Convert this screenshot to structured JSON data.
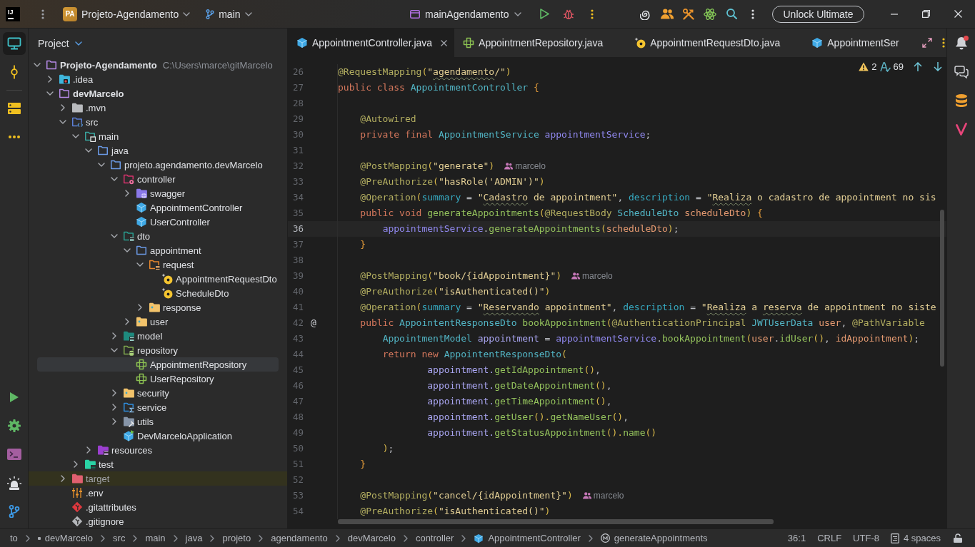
{
  "title_bar": {
    "logo": "IJ",
    "project_badge": "PA",
    "project": "Projeto-Agendamento",
    "branch": "main",
    "run_config": "mainAgendamento",
    "upgrade_button": "Unlock Ultimate"
  },
  "left_toolbar": {
    "top": [
      {
        "kind": "project",
        "selected": true
      },
      {
        "kind": "commit",
        "selected": false
      },
      {
        "kind": "structure",
        "selected": false
      },
      {
        "kind": "more",
        "selected": false
      }
    ],
    "bottom": [
      {
        "kind": "run",
        "selected": false
      },
      {
        "kind": "services",
        "selected": false
      },
      {
        "kind": "terminal",
        "selected": false
      },
      {
        "kind": "problems",
        "selected": false
      },
      {
        "kind": "git",
        "selected": false
      }
    ]
  },
  "project_panel": {
    "title": "Project",
    "tree": [
      {
        "label": "Projeto-Agendamento",
        "path": "C:\\Users\\marce\\gitMarcelo",
        "kind": "module",
        "expanded": true,
        "selected": false,
        "children": [
          {
            "label": ".idea",
            "kind": "idea",
            "expanded": false,
            "selected": false
          },
          {
            "label": "devMarcelo",
            "kind": "module",
            "expanded": true,
            "selected": false,
            "children": [
              {
                "label": ".mvn",
                "kind": "folder",
                "expanded": false,
                "selected": false
              },
              {
                "label": "src",
                "kind": "src",
                "expanded": true,
                "selected": false,
                "children": [
                  {
                    "label": "main",
                    "kind": "sources-root",
                    "expanded": true,
                    "selected": false,
                    "children": [
                      {
                        "label": "java",
                        "kind": "package",
                        "expanded": true,
                        "selected": false,
                        "children": [
                          {
                            "label": "projeto.agendamento.devMarcelo",
                            "kind": "package",
                            "expanded": true,
                            "selected": false,
                            "children": [
                              {
                                "label": "controller",
                                "kind": "controller",
                                "expanded": true,
                                "selected": false,
                                "children": [
                                  {
                                    "label": "swagger",
                                    "kind": "swagger",
                                    "expanded": false,
                                    "selected": false
                                  },
                                  {
                                    "label": "AppointmentController",
                                    "kind": "class",
                                    "selected": false
                                  },
                                  {
                                    "label": "UserController",
                                    "kind": "class",
                                    "selected": false
                                  }
                                ]
                              },
                              {
                                "label": "dto",
                                "kind": "dto",
                                "expanded": true,
                                "selected": false,
                                "children": [
                                  {
                                    "label": "appointment",
                                    "kind": "package",
                                    "expanded": true,
                                    "selected": false,
                                    "children": [
                                      {
                                        "label": "request",
                                        "kind": "request",
                                        "expanded": true,
                                        "selected": false,
                                        "children": [
                                          {
                                            "label": "AppointmentRequestDto",
                                            "kind": "record",
                                            "selected": false
                                          },
                                          {
                                            "label": "ScheduleDto",
                                            "kind": "record",
                                            "selected": false
                                          }
                                        ]
                                      },
                                      {
                                        "label": "response",
                                        "kind": "subpackage",
                                        "expanded": false,
                                        "selected": false
                                      }
                                    ]
                                  },
                                  {
                                    "label": "user",
                                    "kind": "subpackage",
                                    "expanded": false,
                                    "selected": false
                                  }
                                ]
                              },
                              {
                                "label": "model",
                                "kind": "model",
                                "expanded": false,
                                "selected": false
                              },
                              {
                                "label": "repository",
                                "kind": "repository",
                                "expanded": true,
                                "selected": false,
                                "children": [
                                  {
                                    "label": "AppointmentRepository",
                                    "kind": "interface",
                                    "selected": true
                                  },
                                  {
                                    "label": "UserRepository",
                                    "kind": "interface",
                                    "selected": false
                                  }
                                ]
                              },
                              {
                                "label": "security",
                                "kind": "subpackage",
                                "expanded": false,
                                "selected": false
                              },
                              {
                                "label": "service",
                                "kind": "service",
                                "expanded": false,
                                "selected": false
                              },
                              {
                                "label": "utils",
                                "kind": "utils",
                                "expanded": false,
                                "selected": false
                              },
                              {
                                "label": "DevMarceloApplication",
                                "kind": "application",
                                "selected": false
                              }
                            ]
                          }
                        ]
                      },
                      {
                        "label": "resources",
                        "kind": "resources",
                        "expanded": false,
                        "selected": false
                      }
                    ]
                  },
                  {
                    "label": "test",
                    "kind": "test",
                    "expanded": false,
                    "selected": false
                  }
                ]
              },
              {
                "label": "target",
                "kind": "excluded",
                "expanded": false,
                "selected": false
              },
              {
                "label": ".env",
                "kind": "env",
                "selected": false
              },
              {
                "label": ".gitattributes",
                "kind": "git",
                "selected": false
              },
              {
                "label": ".gitignore",
                "kind": "git-ignored",
                "selected": false
              }
            ]
          }
        ]
      }
    ]
  },
  "editor": {
    "tabs": [
      {
        "label": "AppointmentController.java",
        "kind": "class",
        "selected": true
      },
      {
        "label": "AppointmentRepository.java",
        "kind": "interface",
        "selected": false
      },
      {
        "label": "AppointmentRequestDto.java",
        "kind": "record",
        "selected": false
      },
      {
        "label": "AppointmentSer",
        "kind": "class",
        "selected": false
      }
    ],
    "inspections": {
      "warnings": "2",
      "typos": "69"
    },
    "lines": [
      {
        "number": "26",
        "current": false,
        "tokens": [
          {
            "kind": "annotation",
            "text": "@RequestMapping"
          },
          {
            "kind": "bracket",
            "text": "("
          },
          {
            "kind": "string",
            "text": "\""
          },
          {
            "kind": "typo",
            "text": "agendamento"
          },
          {
            "kind": "string",
            "text": "/\""
          },
          {
            "kind": "bracket",
            "text": ")"
          }
        ]
      },
      {
        "number": "27",
        "current": false,
        "tokens": [
          {
            "kind": "keyword",
            "text": "public class "
          },
          {
            "kind": "class",
            "text": "AppointmentController"
          },
          {
            "kind": "brace",
            "text": " {"
          }
        ]
      },
      {
        "number": "28",
        "current": false
      },
      {
        "number": "29",
        "current": false,
        "tokens": [
          {
            "kind": "annotation",
            "text": "    @Autowired"
          }
        ]
      },
      {
        "number": "30",
        "current": false,
        "tokens": [
          {
            "kind": "keyword",
            "text": "    private final "
          },
          {
            "kind": "class",
            "text": "AppointmentService"
          },
          {
            "kind": "field",
            "text": " appointmentService"
          },
          {
            "kind": "plain",
            "text": ";"
          }
        ]
      },
      {
        "number": "31",
        "current": false
      },
      {
        "number": "32",
        "current": false,
        "author": "marcelo",
        "tokens": [
          {
            "kind": "annotation",
            "text": "    @PostMapping"
          },
          {
            "kind": "bracket",
            "text": "("
          },
          {
            "kind": "string",
            "text": "\"generate\""
          },
          {
            "kind": "bracket",
            "text": ")"
          }
        ]
      },
      {
        "number": "33",
        "current": false,
        "tokens": [
          {
            "kind": "annotation",
            "text": "    @PreAuthorize"
          },
          {
            "kind": "bracket",
            "text": "("
          },
          {
            "kind": "string",
            "text": "\"hasRole('ADMIN')\""
          },
          {
            "kind": "bracket",
            "text": ")"
          }
        ]
      },
      {
        "number": "34",
        "current": false,
        "tokens": [
          {
            "kind": "annotation",
            "text": "    @Operation"
          },
          {
            "kind": "bracket",
            "text": "("
          },
          {
            "kind": "named",
            "text": "summary"
          },
          {
            "kind": "plain",
            "text": " = "
          },
          {
            "kind": "string",
            "text": "\""
          },
          {
            "kind": "typo",
            "text": "Cadastro"
          },
          {
            "kind": "string",
            "text": " de appointment\""
          },
          {
            "kind": "plain",
            "text": ", "
          },
          {
            "kind": "named",
            "text": "description"
          },
          {
            "kind": "plain",
            "text": " = "
          },
          {
            "kind": "string",
            "text": "\""
          },
          {
            "kind": "typo",
            "text": "Realiza"
          },
          {
            "kind": "string",
            "text": " o cadastro de appointment no sis"
          }
        ]
      },
      {
        "number": "35",
        "current": false,
        "tokens": [
          {
            "kind": "keyword",
            "text": "    public void "
          },
          {
            "kind": "method",
            "text": "generateAppointments"
          },
          {
            "kind": "bracket",
            "text": "("
          },
          {
            "kind": "annotation",
            "text": "@RequestBody"
          },
          {
            "kind": "class",
            "text": " ScheduleDto"
          },
          {
            "kind": "param",
            "text": " scheduleDto"
          },
          {
            "kind": "bracket",
            "text": ")"
          },
          {
            "kind": "brace",
            "text": " {"
          }
        ]
      },
      {
        "number": "36",
        "current": true,
        "tokens": [
          {
            "kind": "field",
            "text": "        appointmentService"
          },
          {
            "kind": "plain",
            "text": "."
          },
          {
            "kind": "method",
            "text": "generateAppointments"
          },
          {
            "kind": "bracket",
            "text": "("
          },
          {
            "kind": "param",
            "text": "scheduleDto"
          },
          {
            "kind": "bracket",
            "text": ")"
          },
          {
            "kind": "plain",
            "text": ";"
          }
        ]
      },
      {
        "number": "37",
        "current": false,
        "tokens": [
          {
            "kind": "brace",
            "text": "    }"
          }
        ]
      },
      {
        "number": "38",
        "current": false
      },
      {
        "number": "39",
        "current": false,
        "author": "marcelo",
        "tokens": [
          {
            "kind": "annotation",
            "text": "    @PostMapping"
          },
          {
            "kind": "bracket",
            "text": "("
          },
          {
            "kind": "string",
            "text": "\"book/{idAppointment}\""
          },
          {
            "kind": "bracket",
            "text": ")"
          }
        ]
      },
      {
        "number": "40",
        "current": false,
        "tokens": [
          {
            "kind": "annotation",
            "text": "    @PreAuthorize"
          },
          {
            "kind": "bracket",
            "text": "("
          },
          {
            "kind": "string",
            "text": "\"isAuthenticated()\""
          },
          {
            "kind": "bracket",
            "text": ")"
          }
        ]
      },
      {
        "number": "41",
        "current": false,
        "tokens": [
          {
            "kind": "annotation",
            "text": "    @Operation"
          },
          {
            "kind": "bracket",
            "text": "("
          },
          {
            "kind": "named",
            "text": "summary"
          },
          {
            "kind": "plain",
            "text": " = "
          },
          {
            "kind": "string",
            "text": "\""
          },
          {
            "kind": "typo",
            "text": "Reservando"
          },
          {
            "kind": "string",
            "text": " appointment\""
          },
          {
            "kind": "plain",
            "text": ", "
          },
          {
            "kind": "named",
            "text": "description"
          },
          {
            "kind": "plain",
            "text": " = "
          },
          {
            "kind": "string",
            "text": "\""
          },
          {
            "kind": "typo",
            "text": "Realiza"
          },
          {
            "kind": "string",
            "text": " a "
          },
          {
            "kind": "typo",
            "text": "reserva"
          },
          {
            "kind": "string",
            "text": " de appointment no siste"
          }
        ]
      },
      {
        "number": "42",
        "current": false,
        "gutter_mark": "@",
        "tokens": [
          {
            "kind": "keyword",
            "text": "    public "
          },
          {
            "kind": "class",
            "text": "AppointentResponseDto"
          },
          {
            "kind": "method",
            "text": " bookAppointment"
          },
          {
            "kind": "bracket",
            "text": "("
          },
          {
            "kind": "annotation",
            "text": "@AuthenticationPrincipal"
          },
          {
            "kind": "class",
            "text": " JWTUserData"
          },
          {
            "kind": "param",
            "text": " user"
          },
          {
            "kind": "plain",
            "text": ", "
          },
          {
            "kind": "annotation",
            "text": "@PathVariable"
          }
        ]
      },
      {
        "number": "43",
        "current": false,
        "tokens": [
          {
            "kind": "class",
            "text": "        AppointmentModel"
          },
          {
            "kind": "local",
            "text": " appointment"
          },
          {
            "kind": "plain",
            "text": " = "
          },
          {
            "kind": "field",
            "text": "appointmentService"
          },
          {
            "kind": "plain",
            "text": "."
          },
          {
            "kind": "method",
            "text": "bookAppointment"
          },
          {
            "kind": "bracket",
            "text": "("
          },
          {
            "kind": "param",
            "text": "user"
          },
          {
            "kind": "plain",
            "text": "."
          },
          {
            "kind": "method",
            "text": "idUser"
          },
          {
            "kind": "bracket",
            "text": "()"
          },
          {
            "kind": "plain",
            "text": ", "
          },
          {
            "kind": "param",
            "text": "idAppointment"
          },
          {
            "kind": "bracket",
            "text": ")"
          },
          {
            "kind": "plain",
            "text": ";"
          }
        ]
      },
      {
        "number": "44",
        "current": false,
        "tokens": [
          {
            "kind": "keyword",
            "text": "        return new "
          },
          {
            "kind": "class",
            "text": "AppointentResponseDto"
          },
          {
            "kind": "bracket",
            "text": "("
          }
        ]
      },
      {
        "number": "45",
        "current": false,
        "tokens": [
          {
            "kind": "local",
            "text": "                appointment."
          },
          {
            "kind": "method",
            "text": "getIdAppointment"
          },
          {
            "kind": "bracket",
            "text": "()"
          },
          {
            "kind": "plain",
            "text": ","
          }
        ]
      },
      {
        "number": "46",
        "current": false,
        "tokens": [
          {
            "kind": "local",
            "text": "                appointment."
          },
          {
            "kind": "method",
            "text": "getDateAppointment"
          },
          {
            "kind": "bracket",
            "text": "()"
          },
          {
            "kind": "plain",
            "text": ","
          }
        ]
      },
      {
        "number": "47",
        "current": false,
        "tokens": [
          {
            "kind": "local",
            "text": "                appointment."
          },
          {
            "kind": "method",
            "text": "getTimeAppointment"
          },
          {
            "kind": "bracket",
            "text": "()"
          },
          {
            "kind": "plain",
            "text": ","
          }
        ]
      },
      {
        "number": "48",
        "current": false,
        "tokens": [
          {
            "kind": "local",
            "text": "                appointment."
          },
          {
            "kind": "method",
            "text": "getUser"
          },
          {
            "kind": "bracket",
            "text": "()."
          },
          {
            "kind": "method",
            "text": "getNameUser"
          },
          {
            "kind": "bracket",
            "text": "()"
          },
          {
            "kind": "plain",
            "text": ","
          }
        ]
      },
      {
        "number": "49",
        "current": false,
        "tokens": [
          {
            "kind": "local",
            "text": "                appointment."
          },
          {
            "kind": "method",
            "text": "getStatusAppointment"
          },
          {
            "kind": "bracket",
            "text": "()."
          },
          {
            "kind": "method",
            "text": "name"
          },
          {
            "kind": "bracket",
            "text": "()"
          }
        ]
      },
      {
        "number": "50",
        "current": false,
        "tokens": [
          {
            "kind": "bracket",
            "text": "        )"
          },
          {
            "kind": "plain",
            "text": ";"
          }
        ]
      },
      {
        "number": "51",
        "current": false,
        "tokens": [
          {
            "kind": "brace",
            "text": "    }"
          }
        ]
      },
      {
        "number": "52",
        "current": false
      },
      {
        "number": "53",
        "current": false,
        "author": "marcelo",
        "tokens": [
          {
            "kind": "annotation",
            "text": "    @PostMapping"
          },
          {
            "kind": "bracket",
            "text": "("
          },
          {
            "kind": "string",
            "text": "\"cancel/{idAppointment}\""
          },
          {
            "kind": "bracket",
            "text": ")"
          }
        ]
      },
      {
        "number": "54",
        "current": false,
        "tokens": [
          {
            "kind": "annotation",
            "text": "    @PreAuthorize"
          },
          {
            "kind": "bracket",
            "text": "("
          },
          {
            "kind": "string",
            "text": "\"isAuthenticated()\""
          },
          {
            "kind": "bracket",
            "text": ")"
          }
        ]
      }
    ]
  },
  "right_toolbar": [
    {
      "kind": "notifications",
      "unread": true,
      "selected": false
    },
    {
      "kind": "ai-chat",
      "selected": false
    },
    {
      "kind": "database",
      "selected": false
    },
    {
      "kind": "plugin",
      "selected": false
    }
  ],
  "status_bar": {
    "breadcrumbs": [
      {
        "text": "to",
        "kind": "plain"
      },
      {
        "text": "devMarcelo",
        "kind": "module"
      },
      {
        "text": "src",
        "kind": "plain"
      },
      {
        "text": "main",
        "kind": "plain"
      },
      {
        "text": "java",
        "kind": "plain"
      },
      {
        "text": "projeto",
        "kind": "plain"
      },
      {
        "text": "agendamento",
        "kind": "plain"
      },
      {
        "text": "devMarcelo",
        "kind": "plain"
      },
      {
        "text": "controller",
        "kind": "plain"
      },
      {
        "text": "AppointmentController",
        "kind": "class"
      },
      {
        "text": "generateAppointments",
        "kind": "method"
      }
    ],
    "position": "36:1",
    "line_separator": "CRLF",
    "encoding": "UTF-8",
    "indent": "4 spaces"
  }
}
